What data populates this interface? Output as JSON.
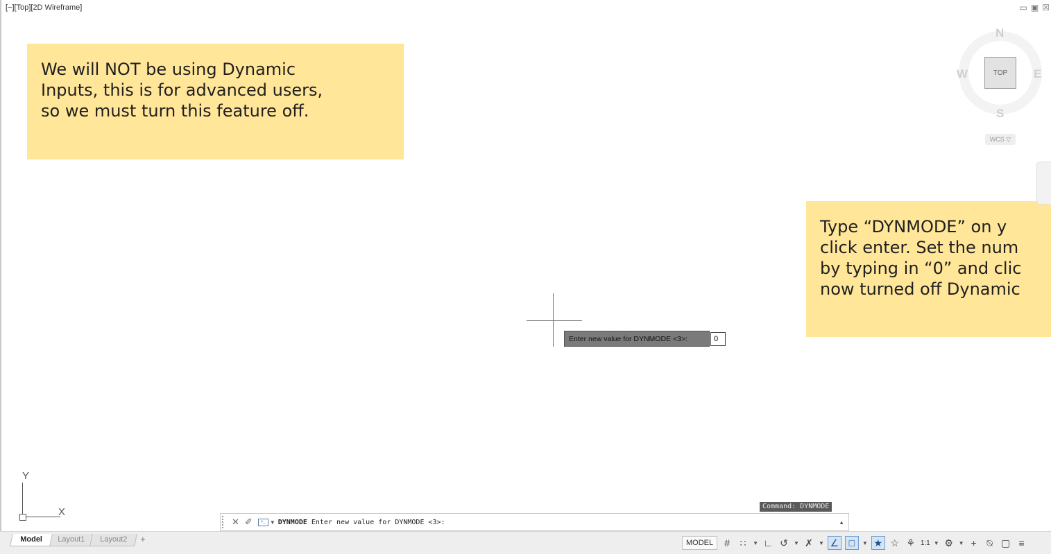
{
  "viewport": {
    "label": "[−][Top][2D Wireframe]",
    "controls": [
      "▭",
      "▣",
      "☒"
    ]
  },
  "notes": {
    "left": [
      "We will NOT be using Dynamic",
      "Inputs, this is for advanced users,",
      "so we must turn this feature off."
    ],
    "right": [
      "Type “DYNMODE” on y",
      "click enter. Set the num",
      "by typing in “0” and clic",
      "now turned off Dynamic"
    ]
  },
  "viewcube": {
    "north": "N",
    "south": "S",
    "east": "E",
    "west": "W",
    "face": "TOP",
    "wcs": "WCS ▽"
  },
  "dynamic_input": {
    "prompt": "Enter new value for DYNMODE <3>:",
    "value": "0"
  },
  "ucs": {
    "x": "X",
    "y": "Y"
  },
  "command_history": "Command: DYNMODE",
  "command_line": {
    "close_icon": "✕",
    "customize_icon": "✐",
    "command_name": "DYNMODE",
    "prompt_text": " Enter new value for DYNMODE <3>:",
    "scroll": "▲"
  },
  "layout_tabs": {
    "items": [
      "Model",
      "Layout1",
      "Layout2"
    ],
    "active": "Model",
    "add": "+"
  },
  "status_bar": {
    "model": "MODEL",
    "grid": "#",
    "snap": "∷",
    "ortho": "∟",
    "polar": "↺",
    "isodraft": "✗",
    "osnap_track": "∠",
    "osnap": "□",
    "annotation_visibility": "★",
    "auto_scale": "☆",
    "annotation_scale_icon": "⚘",
    "scale": "1:1",
    "workspace": "⚙",
    "plus": "+",
    "units": "⍉",
    "fullscreen": "▢",
    "customize": "≡"
  }
}
